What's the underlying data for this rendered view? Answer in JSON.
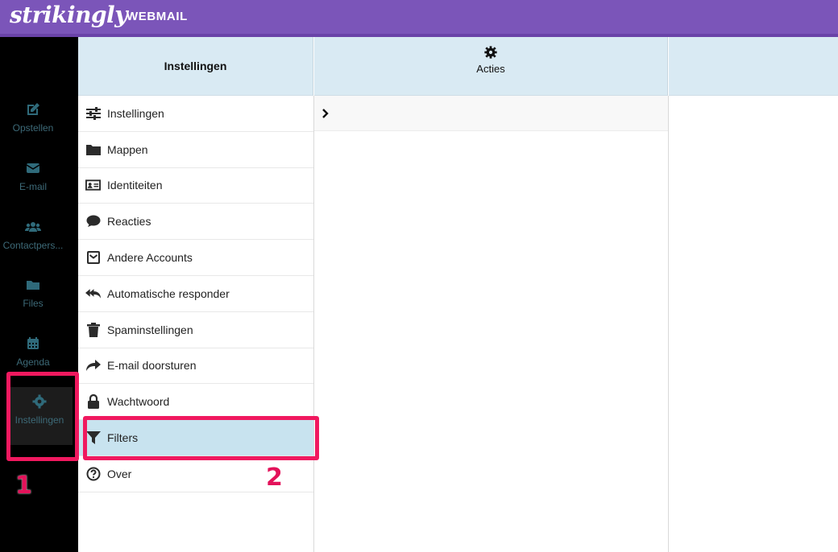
{
  "header": {
    "logo_text": "strikingly",
    "app_title": "WEBMAIL",
    "brand_color": "#7b55b9"
  },
  "leftnav": {
    "items": [
      {
        "label": "Opstellen",
        "icon": "edit-icon"
      },
      {
        "label": "E-mail",
        "icon": "envelope-icon"
      },
      {
        "label": "Contactpers...",
        "icon": "users-icon"
      },
      {
        "label": "Files",
        "icon": "folder-icon"
      },
      {
        "label": "Agenda",
        "icon": "calendar-icon"
      },
      {
        "label": "Instellingen",
        "icon": "gear-icon",
        "active": true
      }
    ]
  },
  "columns": {
    "settings_title": "Instellingen",
    "actions_label": "Acties"
  },
  "settings": {
    "items": [
      {
        "label": "Instellingen",
        "icon": "sliders-icon"
      },
      {
        "label": "Mappen",
        "icon": "folder-icon"
      },
      {
        "label": "Identiteiten",
        "icon": "id-card-icon"
      },
      {
        "label": "Reacties",
        "icon": "comment-icon"
      },
      {
        "label": "Andere Accounts",
        "icon": "envelope-square-icon"
      },
      {
        "label": "Automatische responder",
        "icon": "reply-all-icon"
      },
      {
        "label": "Spaminstellingen",
        "icon": "trash-icon"
      },
      {
        "label": "E-mail doorsturen",
        "icon": "share-icon"
      },
      {
        "label": "Wachtwoord",
        "icon": "lock-icon"
      },
      {
        "label": "Filters",
        "icon": "filter-icon",
        "selected": true
      },
      {
        "label": "Over",
        "icon": "question-circle-icon"
      }
    ]
  },
  "annotations": {
    "step1": "1",
    "step2": "2",
    "color": "#f0195f"
  }
}
